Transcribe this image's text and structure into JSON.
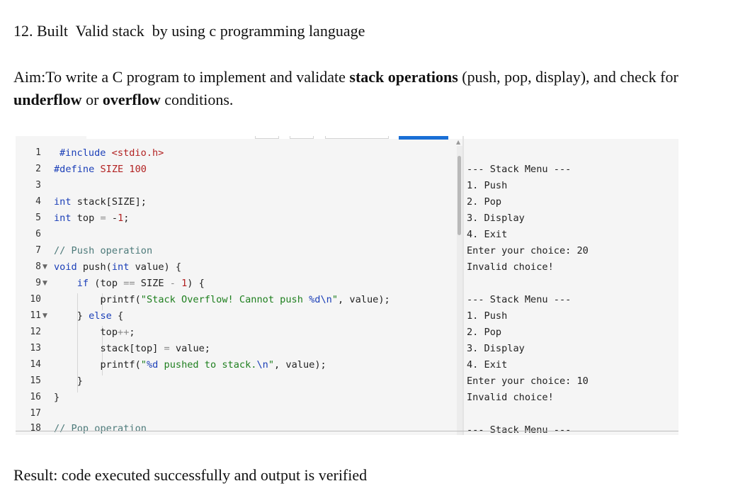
{
  "heading": "12. Built  Valid stack  by using c programming language",
  "aim": {
    "prefix": "Aim:To write a C program to implement and validate ",
    "bold1": "stack operations",
    "mid1": " (push, pop, display), and check for ",
    "bold2": "underflow",
    "mid2": " or ",
    "bold3": "overflow",
    "suffix": " conditions."
  },
  "editor": {
    "line_numbers": [
      "1",
      "2",
      "3",
      "4",
      "5",
      "6",
      "7",
      "8",
      "9",
      "10",
      "11",
      "12",
      "13",
      "14",
      "15",
      "16",
      "17",
      "18"
    ],
    "lines": [
      "#include <stdio.h>",
      "#define SIZE 100",
      "",
      "int stack[SIZE];",
      "int top = -1;",
      "",
      "// Push operation",
      "void push(int value) {",
      "    if (top == SIZE - 1) {",
      "        printf(\"Stack Overflow! Cannot push %d\\n\", value);",
      "    } else {",
      "        top++;",
      "        stack[top] = value;",
      "        printf(\"%d pushed to stack.\\n\", value);",
      "    }",
      "}",
      "",
      "// Pop operation"
    ]
  },
  "output": {
    "lines": [
      "--- Stack Menu ---",
      "1. Push",
      "2. Pop",
      "3. Display",
      "4. Exit",
      "Enter your choice: 20",
      "Invalid choice!",
      "",
      "--- Stack Menu ---",
      "1. Push",
      "2. Pop",
      "3. Display",
      "4. Exit",
      "Enter your choice: 10",
      "Invalid choice!",
      "",
      "--- Stack Menu ---"
    ]
  },
  "result": "Result: code executed successfully and output is verified",
  "colors": {
    "keyword": "#1b3fb8",
    "string": "#1e7f1e",
    "number": "#b22222",
    "comment": "#4d7a7a",
    "tab_active": "#1a6fd6"
  },
  "icons": {
    "fold_marker": "caret-down-icon",
    "scroll_up": "scroll-up-arrow-icon"
  }
}
